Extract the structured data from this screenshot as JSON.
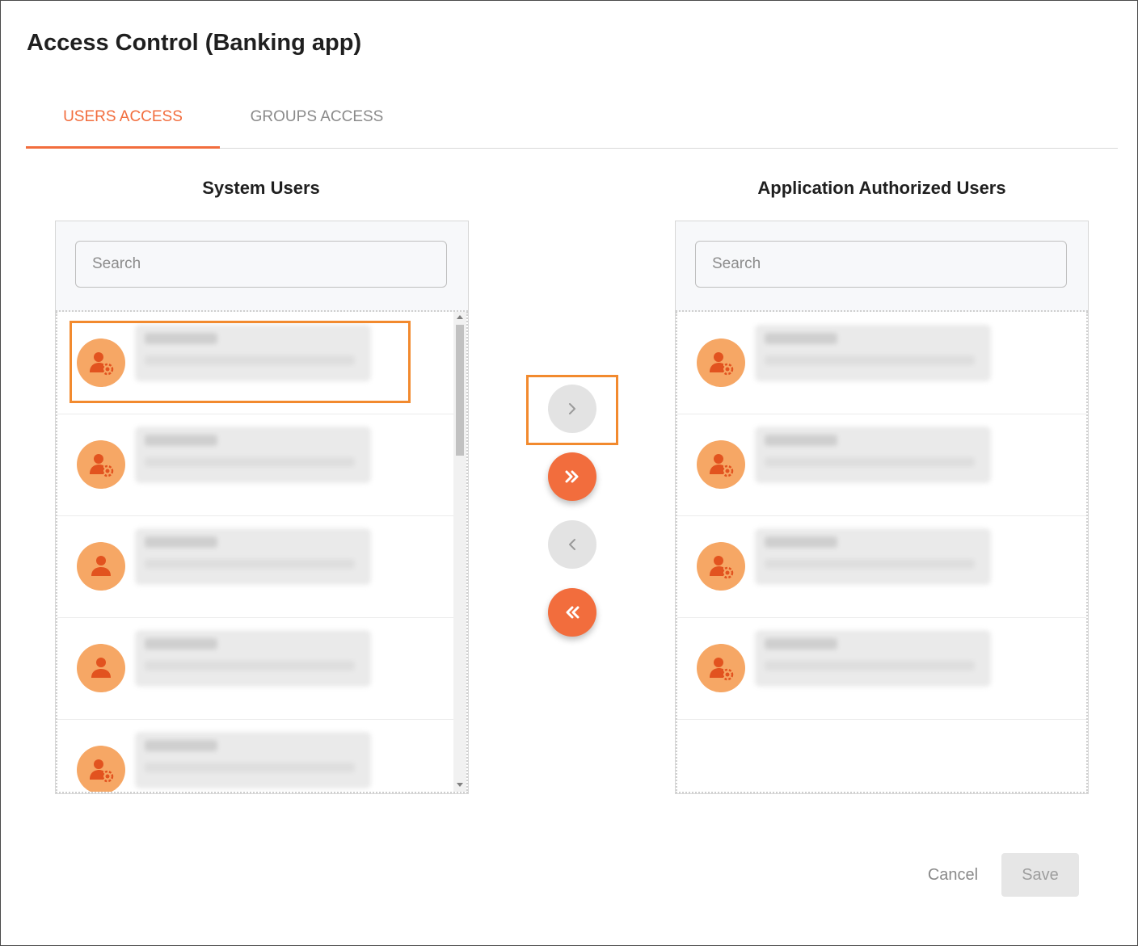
{
  "dialog": {
    "title": "Access Control (Banking app)"
  },
  "tabs": [
    {
      "label": "USERS ACCESS",
      "active": true
    },
    {
      "label": "GROUPS ACCESS",
      "active": false
    }
  ],
  "system_users": {
    "heading": "System Users",
    "search_placeholder": "Search",
    "items": [
      {
        "icon": "user-gear-icon",
        "name": "",
        "email": ""
      },
      {
        "icon": "user-gear-icon",
        "name": "",
        "email": ""
      },
      {
        "icon": "user-icon",
        "name": "",
        "email": ""
      },
      {
        "icon": "user-icon",
        "name": "",
        "email": ""
      },
      {
        "icon": "user-gear-icon",
        "name": "",
        "email": ""
      }
    ]
  },
  "authorized_users": {
    "heading": "Application Authorized Users",
    "search_placeholder": "Search",
    "items": [
      {
        "icon": "user-gear-icon",
        "name": "",
        "email": ""
      },
      {
        "icon": "user-gear-icon",
        "name": "",
        "email": ""
      },
      {
        "icon": "user-gear-icon",
        "name": "",
        "email": ""
      },
      {
        "icon": "user-gear-icon",
        "name": "",
        "email": ""
      }
    ]
  },
  "transfer_buttons": [
    {
      "icon": "chevron-right-icon",
      "enabled": false
    },
    {
      "icon": "double-chevron-right-icon",
      "enabled": true
    },
    {
      "icon": "chevron-left-icon",
      "enabled": false
    },
    {
      "icon": "double-chevron-left-icon",
      "enabled": true
    }
  ],
  "footer": {
    "cancel_label": "Cancel",
    "save_label": "Save"
  },
  "colors": {
    "accent": "#f26d3d",
    "avatar": "#f6a765",
    "icon": "#e2531f",
    "highlight": "#f28a2e"
  }
}
